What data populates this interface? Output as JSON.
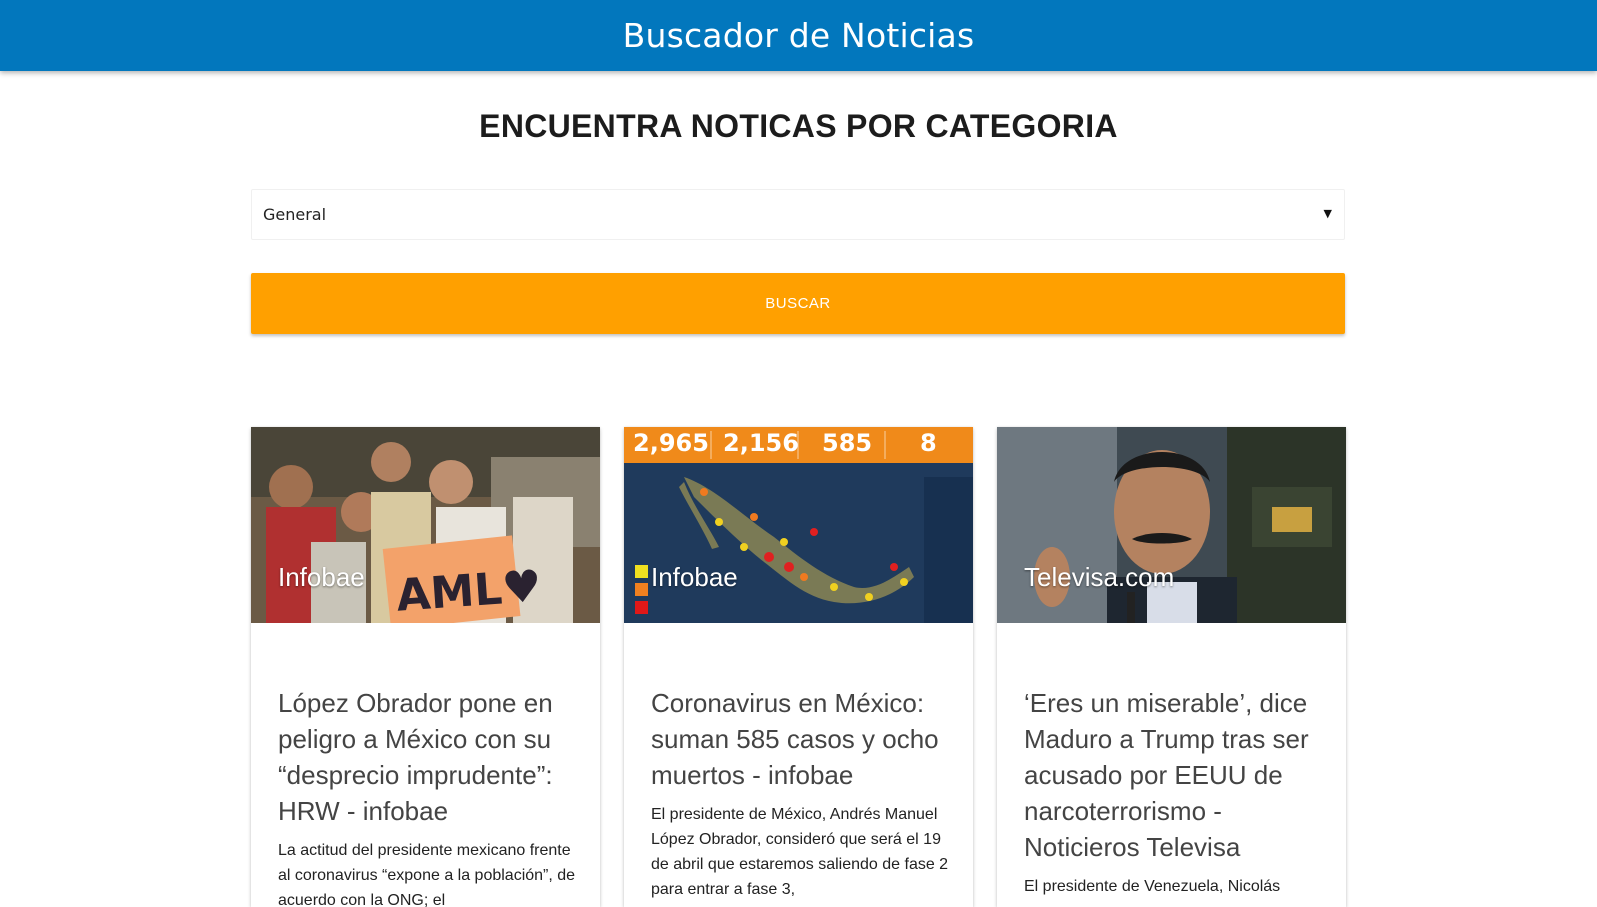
{
  "header": {
    "title": "Buscador de Noticias"
  },
  "main": {
    "heading": "ENCUENTRA NOTICAS POR CATEGORIA",
    "category_select": {
      "selected": "General"
    },
    "search_button": "BUSCAR"
  },
  "articles": [
    {
      "source": "Infobae",
      "title": "López Obrador pone en peligro a México con su “desprecio imprudente”: HRW - infobae",
      "description": "La actitud del presidente mexicano frente al coronavirus “expone a la población”, de acuerdo con la ONG; el"
    },
    {
      "source": "Infobae",
      "title": "Coronavirus en México: suman 585 casos y ocho muertos - infobae",
      "description": "El presidente de México, Andrés Manuel López Obrador, consideró que será el 19 de abril que estaremos saliendo de fase 2 para entrar a fase 3,",
      "image_stats": [
        "2,965",
        "2,156",
        "585",
        "8"
      ]
    },
    {
      "source": "Televisa.com",
      "title": "‘Eres un miserable’, dice Maduro a Trump tras ser acusado por EEUU de narcoterrorismo - Noticieros Televisa",
      "description": "El presidente de Venezuela, Nicolás"
    }
  ],
  "colors": {
    "header": "#0277bd",
    "button": "#ffa000"
  }
}
